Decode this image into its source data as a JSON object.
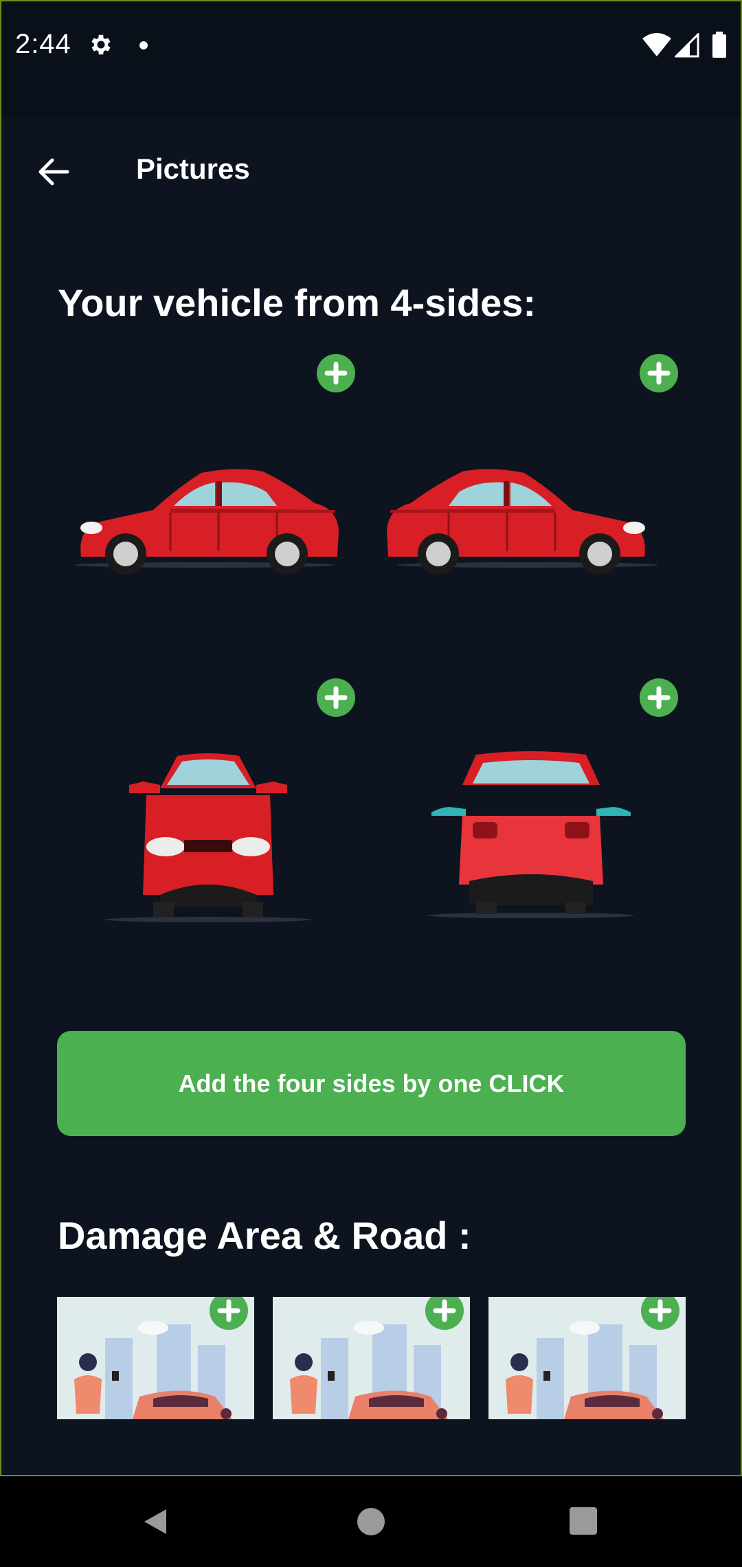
{
  "status_bar": {
    "time": "2:44"
  },
  "app_bar": {
    "title": "Pictures"
  },
  "sections": {
    "vehicle_title": "Your vehicle from 4-sides:",
    "damage_title": "Damage Area & Road :"
  },
  "vehicle_views": [
    "left-side",
    "right-side",
    "front",
    "rear"
  ],
  "add_all_button": {
    "label": "Add the four sides by one CLICK"
  },
  "damage_photos": [
    "photo-1",
    "photo-2",
    "photo-3"
  ],
  "colors": {
    "background": "#0d141f",
    "accent_green": "#4caf50",
    "car_red": "#d81f26"
  }
}
